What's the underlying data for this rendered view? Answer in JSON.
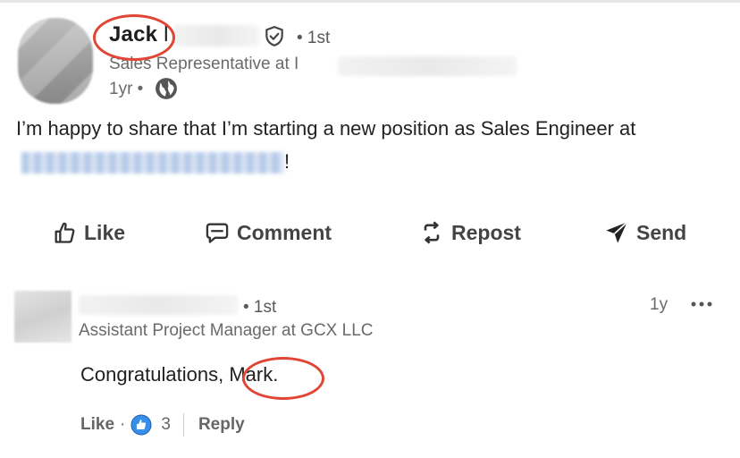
{
  "post": {
    "author_first_name": "Jack",
    "author_name_partial": "l",
    "degree": "• 1st",
    "headline": "Sales Representative at I",
    "time": "1yr •",
    "text": "I’m happy to share that I’m starting a new position as Sales Engineer at",
    "text_end": "!"
  },
  "actions": {
    "like": "Like",
    "comment": "Comment",
    "repost": "Repost",
    "send": "Send"
  },
  "comment": {
    "degree": "• 1st",
    "headline": "Assistant Project Manager at GCX LLC",
    "time": "1y",
    "text": "Congratulations, Mark.",
    "like_label": "Like",
    "separator": "·",
    "reaction_count": "3",
    "reply_label": "Reply"
  },
  "colors": {
    "annotation": "#e04535",
    "link_blue": "#0a66c2",
    "muted_text": "#6a6a6a"
  }
}
